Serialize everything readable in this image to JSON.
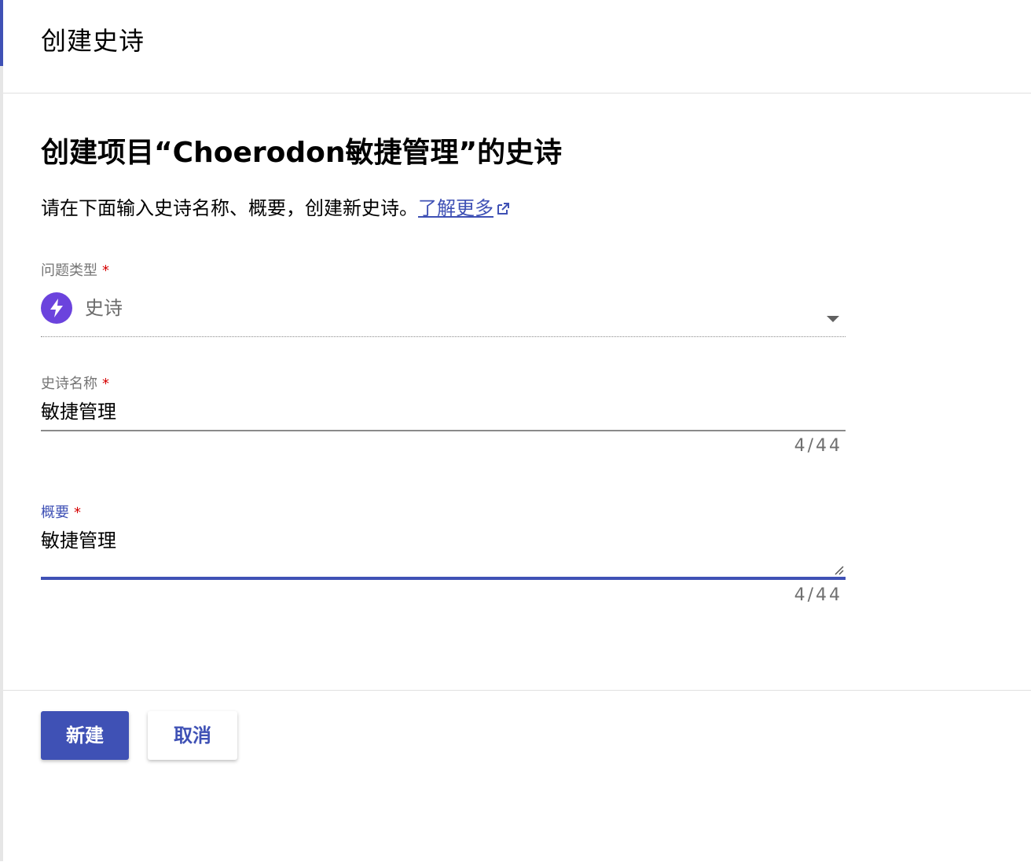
{
  "dialog": {
    "title": "创建史诗"
  },
  "content": {
    "heading": "创建项目“Choerodon敏捷管理”的史诗",
    "intro_text": "请在下面输入史诗名称、概要，创建新史诗。",
    "learn_more_link": "了解更多"
  },
  "form": {
    "issue_type": {
      "label": "问题类型",
      "required_mark": "*",
      "value": "史诗",
      "icon": "lightning-bolt-icon",
      "icon_color": "#6b43dd"
    },
    "epic_name": {
      "label": "史诗名称",
      "required_mark": "*",
      "value": "敏捷管理",
      "counter": "4/44"
    },
    "summary": {
      "label": "概要",
      "required_mark": "*",
      "value": "敏捷管理",
      "counter": "4/44"
    }
  },
  "footer": {
    "create_label": "新建",
    "cancel_label": "取消"
  },
  "colors": {
    "primary": "#3f51b5",
    "required": "#d50000"
  }
}
